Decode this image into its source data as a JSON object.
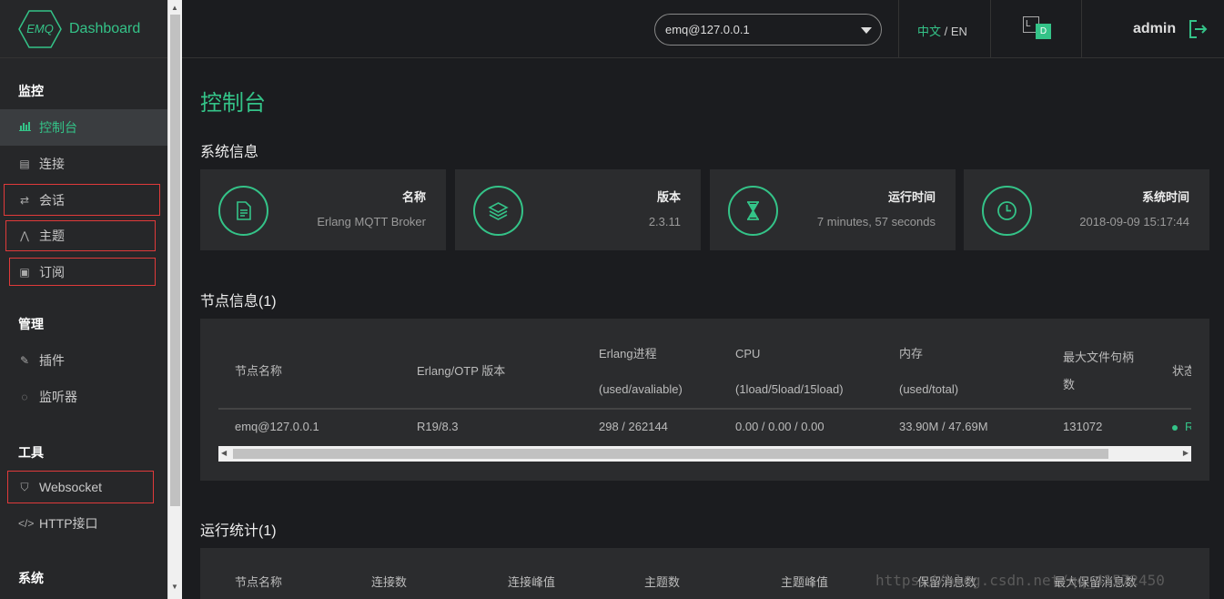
{
  "brand": {
    "logo_text": "EMQ",
    "name": "Dashboard"
  },
  "sidebar": {
    "groups": [
      {
        "label": "监控",
        "items": [
          {
            "label": "控制台"
          },
          {
            "label": "连接"
          },
          {
            "label": "会话"
          },
          {
            "label": "主题"
          },
          {
            "label": "订阅"
          }
        ]
      },
      {
        "label": "管理",
        "items": [
          {
            "label": "插件"
          },
          {
            "label": "监听器"
          }
        ]
      },
      {
        "label": "工具",
        "items": [
          {
            "label": "Websocket"
          },
          {
            "label": "HTTP接口"
          }
        ]
      },
      {
        "label": "系统",
        "items": []
      }
    ]
  },
  "header": {
    "node": "emq@127.0.0.1",
    "lang_zh": "中文",
    "lang_sep": " / ",
    "lang_en": "EN",
    "theme_l": "L",
    "theme_d": "D",
    "user": "admin"
  },
  "main": {
    "title": "控制台",
    "system_info": {
      "title": "系统信息",
      "cards": [
        {
          "label": "名称",
          "value": "Erlang MQTT Broker",
          "icon": "file-icon"
        },
        {
          "label": "版本",
          "value": "2.3.11",
          "icon": "layers-icon"
        },
        {
          "label": "运行时间",
          "value": "7 minutes, 57 seconds",
          "icon": "hourglass-icon"
        },
        {
          "label": "系统时间",
          "value": "2018-09-09 15:17:44",
          "icon": "clock-icon"
        }
      ]
    },
    "nodes": {
      "title": "节点信息(1)",
      "headers": [
        "节点名称",
        "Erlang/OTP 版本",
        "Erlang进程",
        "(used/avaliable)",
        "CPU",
        "(1load/5load/15load)",
        "内存",
        "(used/total)",
        "最大文件句柄",
        "数",
        "状态"
      ],
      "row": [
        "emq@127.0.0.1",
        "R19/8.3",
        "298 / 262144",
        "0.00 / 0.00 / 0.00",
        "33.90M / 47.69M",
        "131072",
        "R"
      ]
    },
    "stats": {
      "title": "运行统计(1)",
      "headers": [
        "节点名称",
        "连接数",
        "连接峰值",
        "主题数",
        "主题峰值",
        "保留消息数",
        "最大保留消息数"
      ]
    }
  },
  "watermark": "https://blog.csdn.net/qq_41572450",
  "colors": {
    "accent": "#34c388",
    "highlight": "#e03a3a",
    "bg": "#1b1c1f",
    "panel": "#2b2c2e"
  }
}
